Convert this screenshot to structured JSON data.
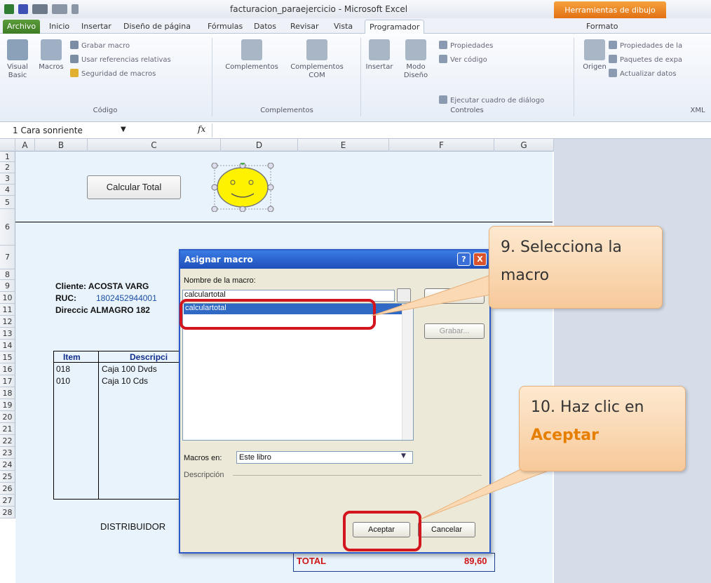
{
  "window": {
    "title": "facturacion_paraejercicio - Microsoft Excel",
    "context_tab": "Herramientas de dibujo"
  },
  "tabs": [
    "Archivo",
    "Inicio",
    "Insertar",
    "Diseño de página",
    "Fórmulas",
    "Datos",
    "Revisar",
    "Vista",
    "Programador",
    "Formato"
  ],
  "ribbon": {
    "codigo": {
      "visual_basic": "Visual Basic",
      "macros": "Macros",
      "grabar": "Grabar macro",
      "usar_ref": "Usar referencias relativas",
      "seguridad": "Seguridad de macros",
      "label": "Código"
    },
    "complementos": {
      "complementos": "Complementos",
      "com": "Complementos COM",
      "label": "Complementos"
    },
    "controles": {
      "insertar": "Insertar",
      "modo": "Modo Diseño",
      "propiedades": "Propiedades",
      "ver_codigo": "Ver código",
      "ejecutar": "Ejecutar cuadro de diálogo",
      "label": "Controles"
    },
    "xml": {
      "origen": "Origen",
      "propiedades": "Propiedades de la",
      "paquetes": "Paquetes de expa",
      "actualizar": "Actualizar datos",
      "label": "XML"
    }
  },
  "formula_bar": {
    "name_box": "1 Cara sonriente",
    "fx": "fx"
  },
  "columns": [
    "A",
    "B",
    "C",
    "D",
    "E",
    "F",
    "G"
  ],
  "rows": [
    "1",
    "2",
    "3",
    "4",
    "5",
    "6",
    "7",
    "8",
    "9",
    "10",
    "11",
    "12",
    "13",
    "14",
    "15",
    "16",
    "17",
    "18",
    "19",
    "20",
    "21",
    "22",
    "23",
    "24",
    "25",
    "26",
    "27",
    "28"
  ],
  "sheet": {
    "button_label": "Calcular Total",
    "cliente": "Cliente: ACOSTA VARG",
    "ruc_label": "RUC:",
    "ruc_value": "1802452944001",
    "direccion": "Direccic ALMAGRO 182",
    "item_header": "Item",
    "desc_header": "Descripci",
    "items": [
      {
        "code": "018",
        "desc": "Caja 100 Dvds"
      },
      {
        "code": "010",
        "desc": "Caja 10 Cds"
      }
    ],
    "distribuidor": "DISTRIBUIDOR",
    "total_label": "TOTAL",
    "total_value": "89,60"
  },
  "dialog": {
    "title": "Asignar macro",
    "help": "?",
    "close": "X",
    "name_label": "Nombre de la macro:",
    "name_value": "calculartotal",
    "list_items": [
      "calculartotal"
    ],
    "grabar": "Grabar...",
    "macros_en_label": "Macros en:",
    "macros_en_value": "Este libro",
    "descripcion": "Descripción",
    "aceptar": "Aceptar",
    "cancelar": "Cancelar"
  },
  "callouts": {
    "step9": "9. Selecciona la macro",
    "step10_text": "10. Haz clic en",
    "step10_emph": "Aceptar"
  },
  "colors": {
    "callout_emph": "#e67e00",
    "highlight": "#d3151e",
    "dialog_title": "#1f4fbb"
  }
}
